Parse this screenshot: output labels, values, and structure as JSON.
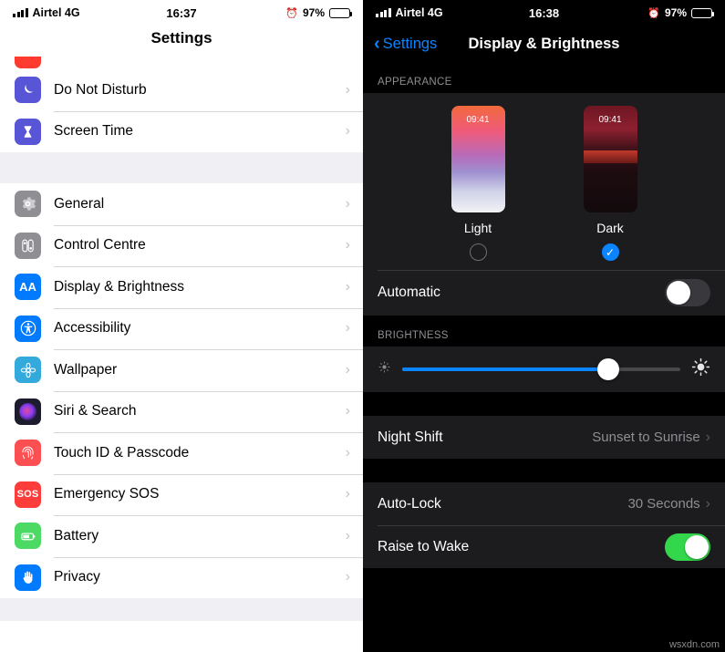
{
  "left": {
    "status": {
      "carrier": "Airtel 4G",
      "network": "4G",
      "time": "16:37",
      "battery": "97%",
      "alarm_icon": "alarm-icon"
    },
    "nav_title": "Settings",
    "groups": [
      {
        "rows": [
          {
            "label": "Do Not Disturb",
            "icon": "moon-icon",
            "color": "#5856d6"
          },
          {
            "label": "Screen Time",
            "icon": "hourglass-icon",
            "color": "#5856d6"
          }
        ]
      },
      {
        "rows": [
          {
            "label": "General",
            "icon": "gear-icon",
            "color": "#8e8e93"
          },
          {
            "label": "Control Centre",
            "icon": "sliders-icon",
            "color": "#8e8e93"
          },
          {
            "label": "Display & Brightness",
            "icon": "aa-icon",
            "color": "#007aff"
          },
          {
            "label": "Accessibility",
            "icon": "accessibility-icon",
            "color": "#007aff"
          },
          {
            "label": "Wallpaper",
            "icon": "flower-icon",
            "color": "#34aadc"
          },
          {
            "label": "Siri & Search",
            "icon": "siri-icon",
            "color": "#1c1c3c"
          },
          {
            "label": "Touch ID & Passcode",
            "icon": "fingerprint-icon",
            "color": "#ff3b30"
          },
          {
            "label": "Emergency SOS",
            "icon": "sos-icon",
            "color": "#ff3b30"
          },
          {
            "label": "Battery",
            "icon": "battery-icon",
            "color": "#4cd964"
          },
          {
            "label": "Privacy",
            "icon": "hand-icon",
            "color": "#007aff"
          }
        ]
      }
    ],
    "chevron": "›"
  },
  "right": {
    "status": {
      "carrier": "Airtel 4G",
      "time": "16:38",
      "battery": "97%",
      "alarm_icon": "alarm-icon"
    },
    "back_label": "Settings",
    "nav_title": "Display & Brightness",
    "appearance_header": "APPEARANCE",
    "appearance": {
      "options": [
        {
          "name": "Light",
          "preview_time": "09:41",
          "selected": false
        },
        {
          "name": "Dark",
          "preview_time": "09:41",
          "selected": true
        }
      ],
      "check_glyph": "✓",
      "automatic_label": "Automatic",
      "automatic_on": false
    },
    "brightness_header": "BRIGHTNESS",
    "brightness": {
      "value_percent": 74,
      "low_icon": "sun-low-icon",
      "high_icon": "sun-high-icon"
    },
    "rows": [
      {
        "label": "Night Shift",
        "value": "Sunset to Sunrise",
        "has_chevron": true
      },
      {
        "label": "Auto-Lock",
        "value": "30 Seconds",
        "has_chevron": true
      },
      {
        "label": "Raise to Wake",
        "value": "",
        "has_chevron": false,
        "toggle_on": true
      }
    ],
    "chevron": "›"
  },
  "watermark": "wsxdn.com",
  "colors": {
    "accent_blue": "#0a84ff",
    "green": "#32d74b",
    "light_bg": "#efeff4",
    "dark_bg": "#1c1c1e"
  }
}
